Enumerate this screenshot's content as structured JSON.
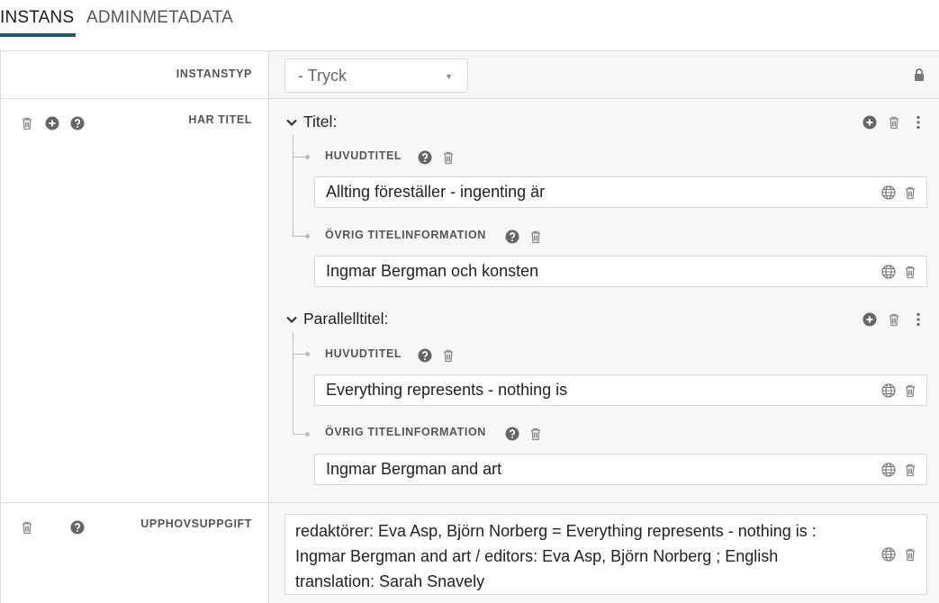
{
  "tabs": [
    {
      "label": "INSTANS",
      "active": true
    },
    {
      "label": "ADMINMETADATA",
      "active": false
    }
  ],
  "instanstyp": {
    "label": "INSTANSTYP",
    "selected": "- Tryck"
  },
  "har_titel": {
    "label": "HAR TITEL",
    "groups": [
      {
        "title": "Titel:",
        "fields": [
          {
            "label": "HUVUDTITEL",
            "value": "Allting föreställer - ingenting är"
          },
          {
            "label": "ÖVRIG TITELINFORMATION",
            "value": "Ingmar Bergman och konsten"
          }
        ]
      },
      {
        "title": "Parallelltitel:",
        "fields": [
          {
            "label": "HUVUDTITEL",
            "value": "Everything represents - nothing is"
          },
          {
            "label": "ÖVRIG TITELINFORMATION",
            "value": "Ingmar Bergman and art"
          }
        ]
      }
    ]
  },
  "upphovsuppgift": {
    "label": "UPPHOVSUPPGIFT",
    "lines": [
      "redaktörer: Eva Asp, Björn Norberg = Everything represents - nothing is :",
      "Ingmar Bergman and art / editors: Eva Asp, Björn Norberg ; English",
      "translation: Sarah Snavely"
    ]
  },
  "colors": {
    "accent": "#1f5a73",
    "icon": "#777777",
    "border": "#dddddd"
  },
  "icons": [
    "trash-icon",
    "plus-circle-icon",
    "help-icon",
    "lock-icon",
    "chevron-down-icon",
    "kebab-menu-icon",
    "globe-icon"
  ]
}
